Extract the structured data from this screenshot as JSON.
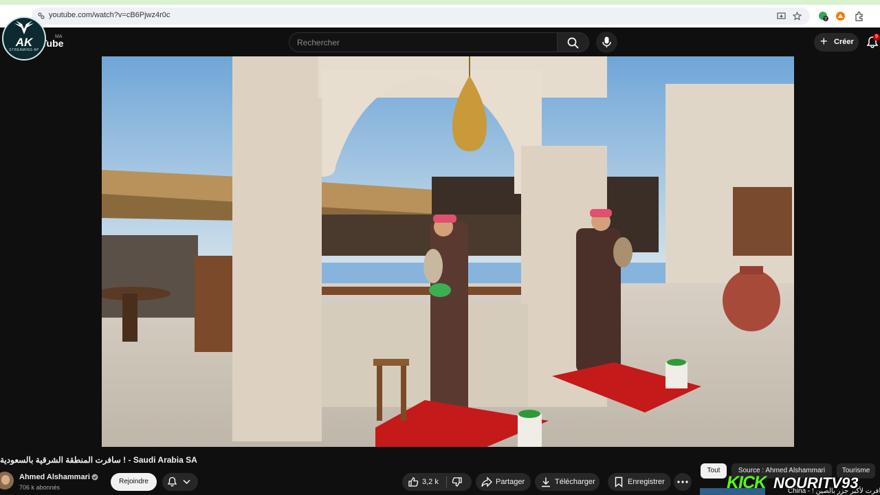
{
  "browser": {
    "url": "youtube.com/watch?v=cB6Pjwz4r0c",
    "extension_badge": "7"
  },
  "channel_badge": {
    "title": "AK",
    "subtitle": "STREAMING AP"
  },
  "youtube": {
    "logo": "Tube",
    "country_code": "MA",
    "search_placeholder": "Rechercher",
    "create_label": "Créer",
    "notification_count": "9"
  },
  "video": {
    "title": "سافرت المنطقة الشرقية بالسعودية ! - Saudi Arabia SA",
    "scene": "courtyard-falconry"
  },
  "owner": {
    "name": "Ahmed Alshammari",
    "subscribers": "706 k abonnés",
    "join_label": "Rejoindre"
  },
  "actions": {
    "like_count": "3,2 k",
    "share_label": "Partager",
    "download_label": "Télécharger",
    "save_label": "Enregistrer"
  },
  "chips": [
    "Tout",
    "Source : Ahmed Alshammari",
    "Tourisme"
  ],
  "recommendation": {
    "title_fragment": "China - ! سافرت لأكبر جزر بالصين"
  },
  "overlay": {
    "kick_label": "KICK",
    "streamer": "NOURITV93"
  },
  "colors": {
    "background": "#0f0f0f",
    "kick_green": "#53fc18",
    "notification_red": "#cc0000"
  }
}
